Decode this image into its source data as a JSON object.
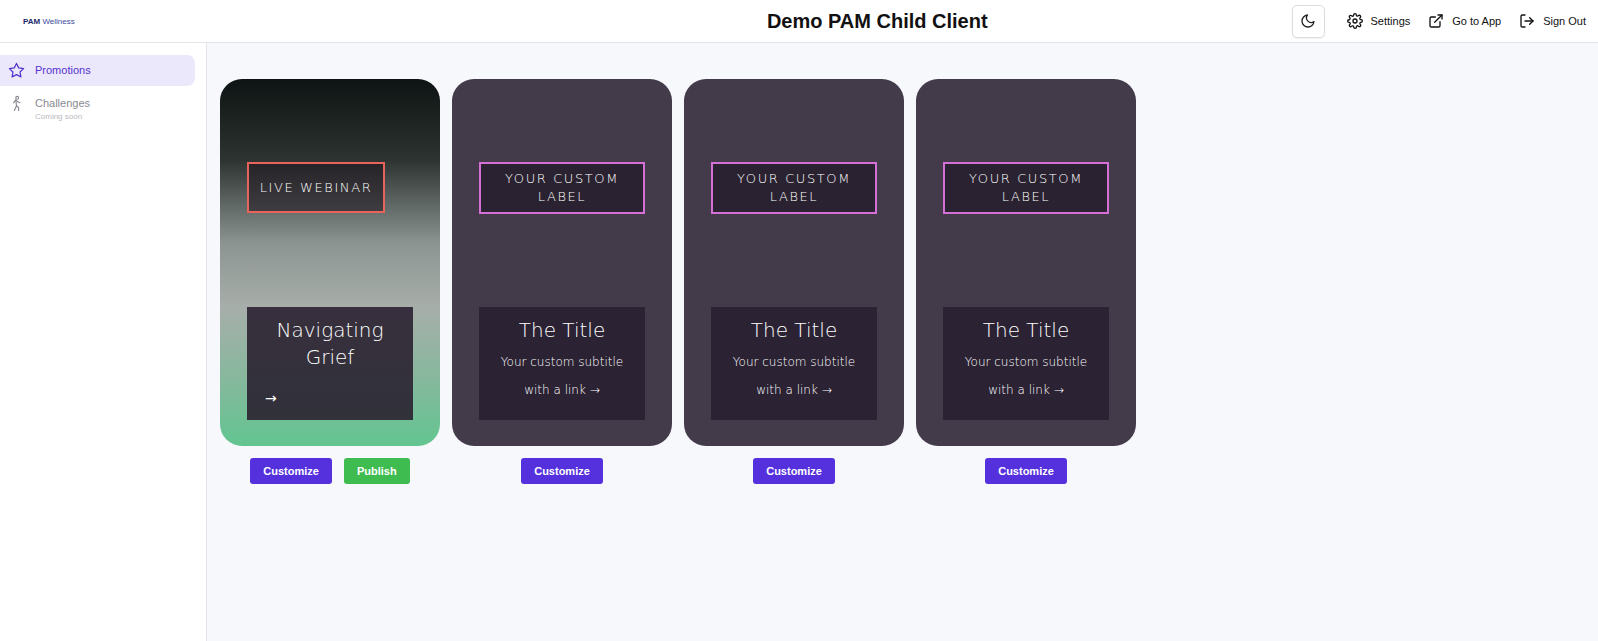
{
  "header": {
    "logo": {
      "brand": "PAM",
      "suffix": "Wellness"
    },
    "title": "Demo PAM Child Client",
    "actions": [
      {
        "kind": "theme"
      },
      {
        "kind": "settings",
        "label": "Settings"
      },
      {
        "kind": "open",
        "label": "Go to App"
      },
      {
        "kind": "signout",
        "label": "Sign Out"
      }
    ]
  },
  "sidebar": {
    "items": [
      {
        "label": "Promotions",
        "icon": "star",
        "selected": true,
        "disabled": false
      },
      {
        "label": "Challenges",
        "sub": "Coming soon",
        "icon": "walk",
        "selected": false,
        "disabled": true
      }
    ]
  },
  "cards": [
    {
      "kind": "photo",
      "label": "LIVE WEBINAR",
      "color": "#e8645a",
      "title": "Navigating Grief",
      "arrow": "→",
      "buttons": [
        {
          "label": "Customize",
          "kind": "customize"
        },
        {
          "label": "Publish",
          "kind": "publish"
        }
      ]
    },
    {
      "kind": "plain",
      "label": "YOUR CUSTOM LABEL",
      "color": "#d46fd8",
      "title": "The Title",
      "subtitle": "Your custom subtitle with a link",
      "arrow": "→",
      "buttons": [
        {
          "label": "Customize",
          "kind": "customize"
        }
      ]
    },
    {
      "kind": "plain",
      "label": "YOUR CUSTOM LABEL",
      "color": "#d46fd8",
      "title": "The Title",
      "subtitle": "Your custom subtitle with a link",
      "arrow": "→",
      "buttons": [
        {
          "label": "Customize",
          "kind": "customize"
        }
      ]
    },
    {
      "kind": "plain",
      "label": "YOUR CUSTOM LABEL",
      "color": "#d46fd8",
      "title": "The Title",
      "subtitle": "Your custom subtitle with a link",
      "arrow": "→",
      "buttons": [
        {
          "label": "Customize",
          "kind": "customize"
        }
      ]
    }
  ]
}
